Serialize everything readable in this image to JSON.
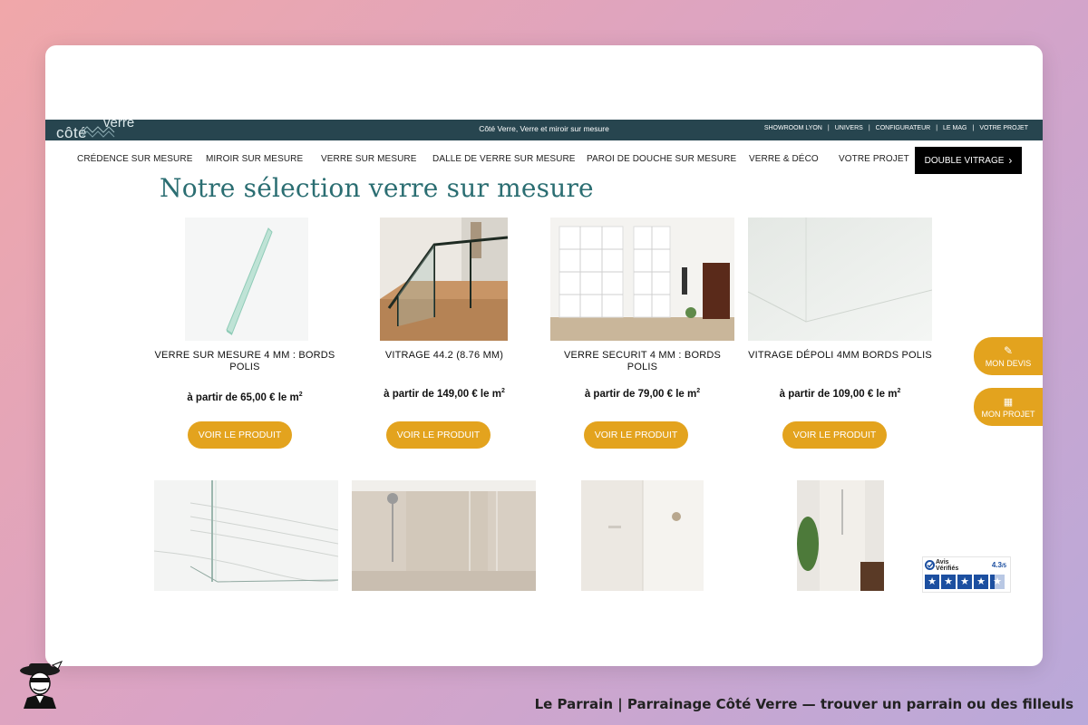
{
  "site": {
    "logo_word1": "côté",
    "logo_word2": "verre",
    "tagline": "Côté Verre, Verre et miroir sur mesure",
    "top_links": [
      "SHOWROOM LYON",
      "UNIVERS",
      "CONFIGURATEUR",
      "LE MAG",
      "VOTRE PROJET"
    ]
  },
  "nav": {
    "items": [
      "CRÉDENCE SUR MESURE",
      "MIROIR SUR MESURE",
      "VERRE SUR MESURE",
      "DALLE DE VERRE SUR MESURE",
      "PAROI DE DOUCHE SUR MESURE",
      "VERRE & DÉCO",
      "VOTRE PROJET"
    ],
    "cta": "DOUBLE VITRAGE"
  },
  "main": {
    "title": "Notre sélection verre sur mesure",
    "products": [
      {
        "name": "VERRE SUR MESURE 4 MM : BORDS POLIS",
        "price_prefix": "à partir de",
        "price": "65,00 €",
        "unit": "le m",
        "button": "VOIR LE PRODUIT"
      },
      {
        "name": "VITRAGE 44.2 (8.76 MM)",
        "price_prefix": "à partir de",
        "price": "149,00 €",
        "unit": "le m",
        "button": "VOIR LE PRODUIT"
      },
      {
        "name": "VERRE SECURIT 4 MM : BORDS POLIS",
        "price_prefix": "à partir de",
        "price": "79,00 €",
        "unit": "le m",
        "button": "VOIR LE PRODUIT"
      },
      {
        "name": "VITRAGE DÉPOLI 4MM BORDS POLIS",
        "price_prefix": "à partir de",
        "price": "109,00 €",
        "unit": "le m",
        "button": "VOIR LE PRODUIT"
      }
    ],
    "unit_sup": "2"
  },
  "side": {
    "devis": "MON DEVIS",
    "projet": "MON PROJET"
  },
  "avis": {
    "brand_line1": "Avis",
    "brand_line2": "Vérifiés",
    "score": "4.3",
    "score_max": "/5",
    "rating": 4.3
  },
  "footer": {
    "text": "Le Parrain | Parrainage Côté Verre — trouver un parrain ou des filleuls"
  },
  "colors": {
    "accent": "#e3a31e",
    "topbar": "#27454f",
    "title": "#2b6e72",
    "avis_blue": "#1c4fa0"
  }
}
